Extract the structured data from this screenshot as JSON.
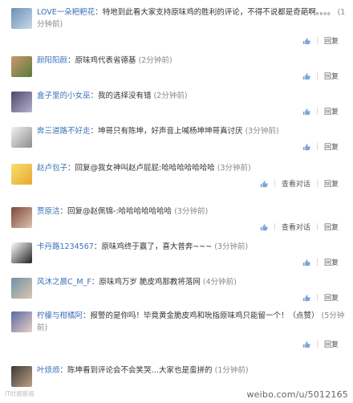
{
  "comments": [
    {
      "user": "LOVE一朵粑粑花",
      "sep": "：",
      "text": "特地到此看大家支持原味鸡的胜利的评论，不得不说都是奇葩啊。。。。",
      "time": "(1分钟前)",
      "like": "",
      "reply": "回复",
      "view": "",
      "colors": [
        "#6b8fb5",
        "#c9d9ea"
      ]
    },
    {
      "user": "颜阳阳颜",
      "sep": "：",
      "text": "原味鸡代表省德基",
      "time": "(2分钟前)",
      "like": "",
      "reply": "回复",
      "view": "",
      "colors": [
        "#c89a6a",
        "#5b7a3f"
      ]
    },
    {
      "user": "盒子里的小女巫",
      "sep": "：",
      "text": "我的选择没有错",
      "time": "(2分钟前)",
      "like": "",
      "reply": "回复",
      "view": "",
      "colors": [
        "#4a4a6a",
        "#b9aed0"
      ]
    },
    {
      "user": "奔三道路不好走",
      "sep": "：",
      "text": "坤哥只有陈坤，好声音上喊杨坤坤哥真讨厌",
      "time": "(3分钟前)",
      "like": "",
      "reply": "回复",
      "view": "",
      "colors": [
        "#f2f2f2",
        "#8c8c8c"
      ]
    },
    {
      "user": "赵卢包子",
      "sep": "：",
      "text": "回复@我女神叫赵卢屁屁:哈哈哈哈哈哈哈",
      "time": "(3分钟前)",
      "like": "",
      "reply": "回复",
      "view": "查看对话",
      "colors": [
        "#f6e070",
        "#e8a830"
      ]
    },
    {
      "user": "贾原洁",
      "sep": "：",
      "text": "回复@赵佩锦-:哈哈哈哈哈哈哈",
      "time": "(3分钟前)",
      "like": "",
      "reply": "回复",
      "view": "查看对话",
      "colors": [
        "#7a4a3a",
        "#e0c0b0"
      ]
    },
    {
      "user": "卡丹路1234567",
      "sep": "：",
      "text": "原味鸡终于赢了，喜大普奔~~~",
      "time": "(3分钟前)",
      "like": "",
      "reply": "回复",
      "view": "",
      "colors": [
        "#ffffff",
        "#222222"
      ]
    },
    {
      "user": "风沐之晨C_M_F",
      "sep": "：",
      "text": "原味鸡万岁 脆皮鸡那教将落网",
      "time": "(4分钟前)",
      "like": "",
      "reply": "回复",
      "view": "",
      "colors": [
        "#7090a8",
        "#d9c8b0"
      ]
    },
    {
      "user": "柠檬与柑橘阿",
      "sep": "：",
      "text": "报警的是你吗！毕竟黄金脆皮鸡和吮指原味鸡只能留一个！（点赞",
      "text2": "）",
      "time": "(5分钟前)",
      "like": "",
      "reply": "回复",
      "view": "",
      "colors": [
        "#5a6aa0",
        "#e8d0c8"
      ]
    },
    {
      "user": "叶烦烦",
      "sep": "：",
      "text": "陈坤看到评论会不会笑哭…大家也是蛮拼的",
      "time": "(1分钟前)",
      "like": "",
      "reply": "",
      "view": "",
      "colors": [
        "#3a3a3a",
        "#c0a080"
      ]
    }
  ],
  "watermark_left": "IT时报新闻",
  "watermark_right": "weibo.com/u/5012165"
}
